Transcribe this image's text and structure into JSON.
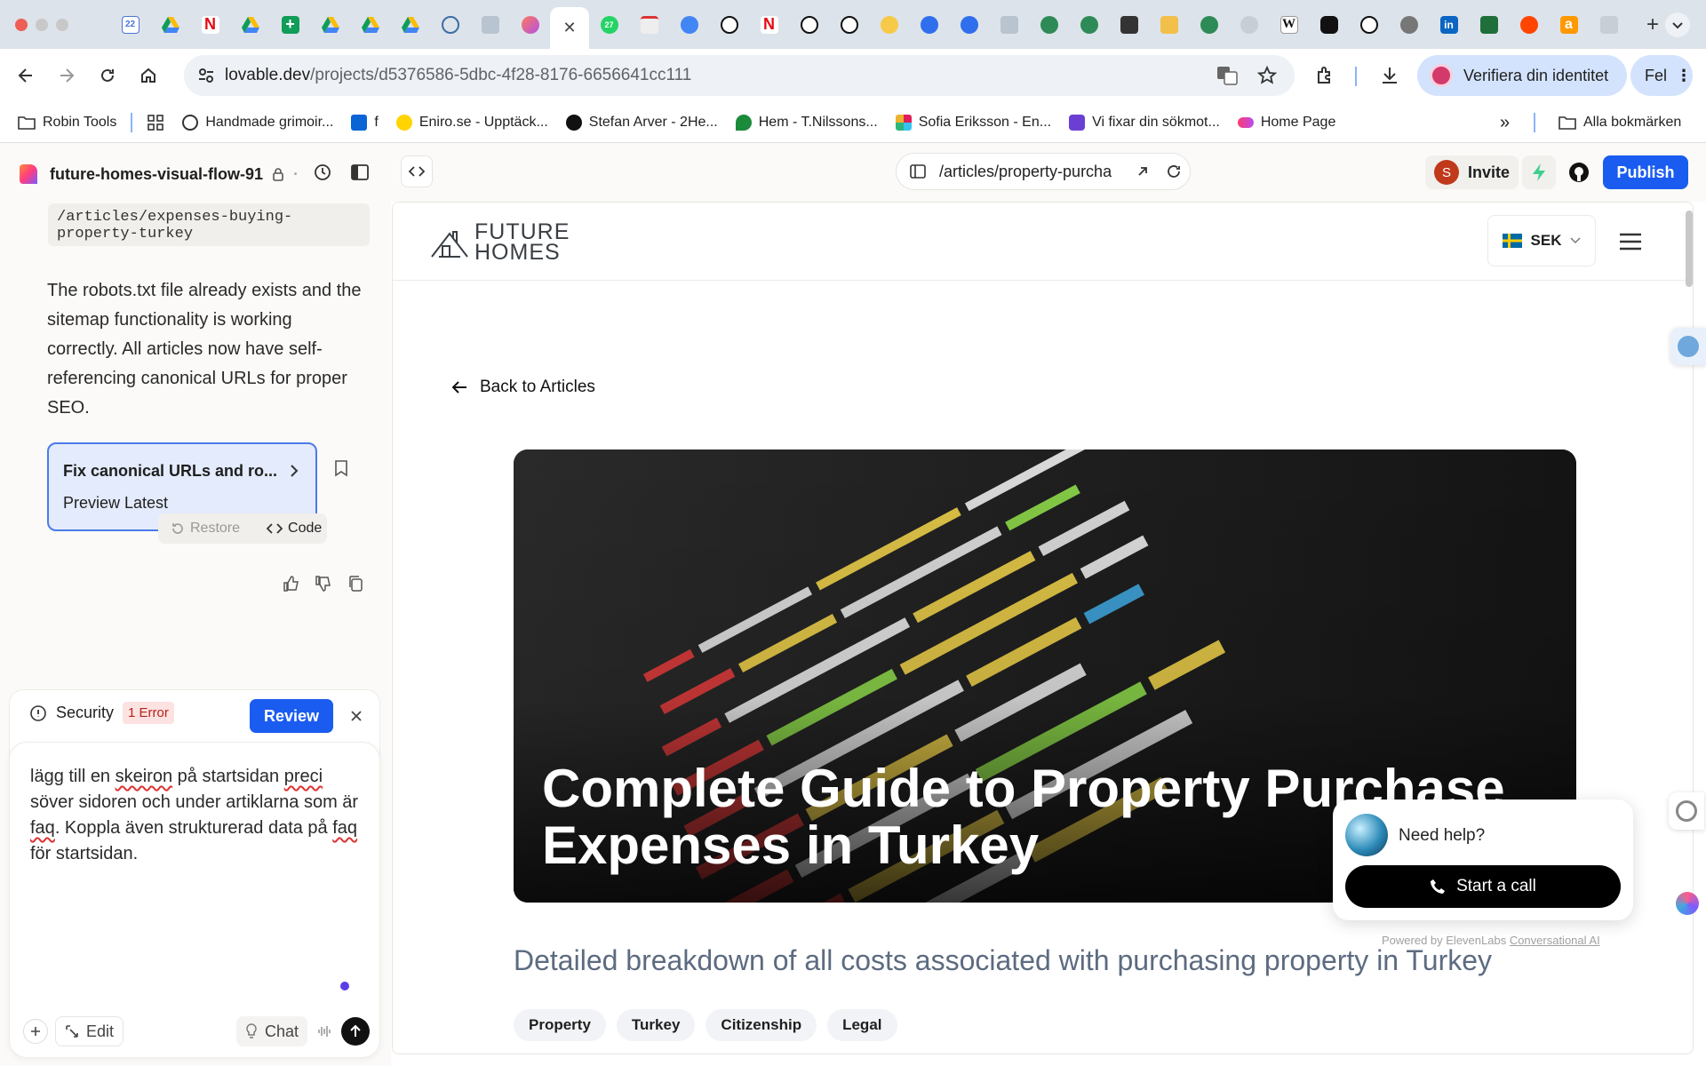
{
  "browser": {
    "url_host": "lovable.dev",
    "url_path": "/projects/d5376586-5dbc-4f28-8176-6656641cc111",
    "verify_label": "Verifiera din identitet",
    "profile_label": "Fel",
    "tab_count_badge": "22",
    "tab_badge_27": "27"
  },
  "bookmarks": [
    {
      "label": "Robin Tools",
      "icon": "folder-icon"
    },
    {
      "label": "",
      "icon": "grid-icon"
    },
    {
      "label": "Handmade grimoir...",
      "icon": "site-icon"
    },
    {
      "label": "f",
      "icon": "outlook-icon"
    },
    {
      "label": "Eniro.se - Upptäck...",
      "icon": "eniro-icon"
    },
    {
      "label": "Stefan Arver - 2He...",
      "icon": "heart-icon"
    },
    {
      "label": "Hem - T.Nilssons...",
      "icon": "leaf-icon"
    },
    {
      "label": "Sofia Eriksson - En...",
      "icon": "slack-icon"
    },
    {
      "label": "Vi fixar din sökmot...",
      "icon": "r-icon"
    },
    {
      "label": "Home Page",
      "icon": "pill-icon"
    }
  ],
  "bookmarks_all": "Alla bokmärken",
  "app": {
    "project_name": "future-homes-visual-flow-91",
    "preview_path": "/articles/property-purcha",
    "invite_label": "Invite",
    "avatar_letter": "S",
    "publish_label": "Publish"
  },
  "chat": {
    "code_path": "/articles/expenses-buying-property-turkey",
    "message": "The robots.txt file already exists and the sitemap functionality is working correctly. All articles now have self-referencing canonical URLs for proper SEO.",
    "card_title": "Fix canonical URLs and ro...",
    "card_subtitle": "Preview Latest",
    "restore_label": "Restore",
    "code_label": "Code",
    "security_label": "Security",
    "error_badge": "1 Error",
    "review_label": "Review",
    "input_text_1": "lägg till en ",
    "input_spell_1": "skeiron",
    "input_text_2": " på startsidan ",
    "input_spell_2": "preci",
    "input_text_3": " söver sidoren och under artiklarna som är ",
    "input_spell_3": "faq",
    "input_text_4": ". Koppla även strukturerad data på ",
    "input_spell_4": "faq",
    "input_text_5": " för startsidan.",
    "edit_label": "Edit",
    "chat_label": "Chat"
  },
  "site": {
    "logo_line1": "FUTURE",
    "logo_line2": "HOMES",
    "currency": "SEK",
    "back_label": "Back to Articles",
    "hero_title": "Complete Guide to Property Purchase Expenses in Turkey",
    "subtitle": "Detailed breakdown of all costs associated with purchasing property in Turkey",
    "tags": [
      "Property",
      "Turkey",
      "Citizenship",
      "Legal"
    ]
  },
  "help_widget": {
    "question": "Need help?",
    "call_label": "Start a call",
    "powered_prefix": "Powered by ElevenLabs ",
    "powered_link": "Conversational AI"
  },
  "colors": {
    "accent_blue": "#1a5cf0",
    "tabstrip": "#dde3ea",
    "error_red": "#b42318"
  }
}
